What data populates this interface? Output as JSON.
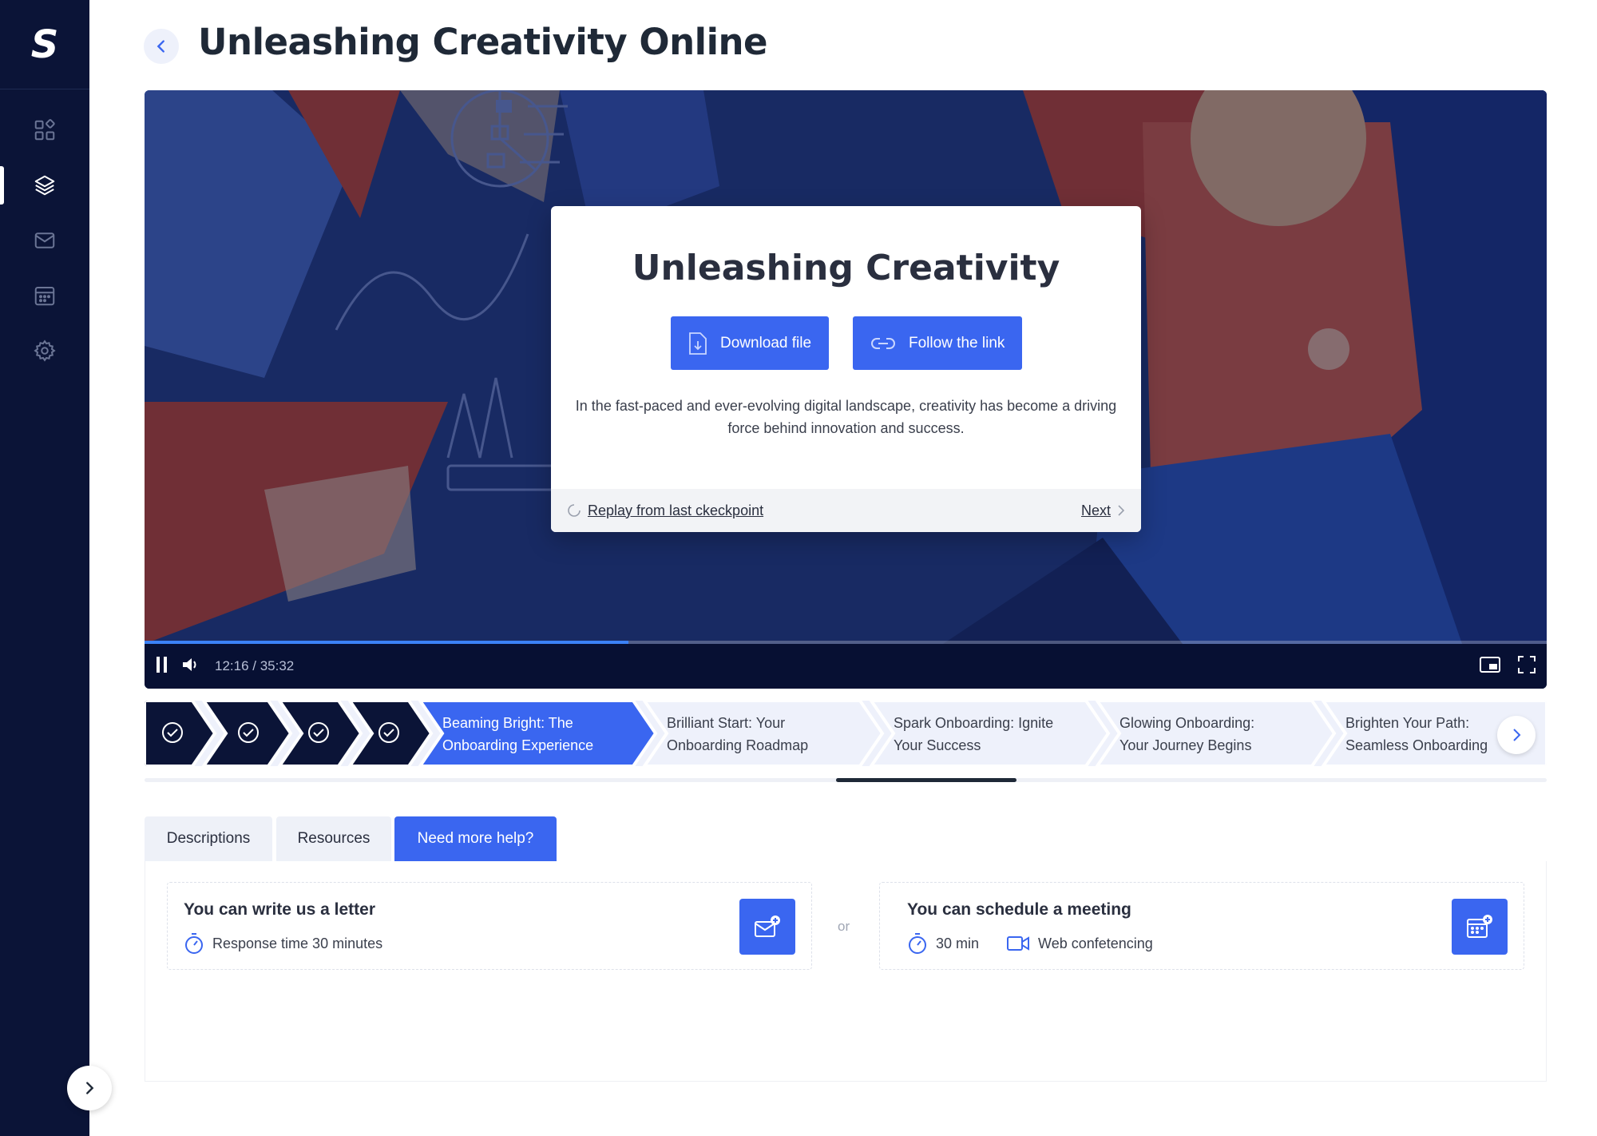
{
  "app": {
    "logo_text": "S",
    "page_title": "Unleashing Creativity Online"
  },
  "sidebar": {
    "items": [
      {
        "icon": "widgets-icon",
        "active": false
      },
      {
        "icon": "layers-icon",
        "active": true
      },
      {
        "icon": "mail-icon",
        "active": false
      },
      {
        "icon": "calendar-icon",
        "active": false
      },
      {
        "icon": "gear-icon",
        "active": false
      }
    ]
  },
  "video": {
    "time_text": "12:16 / 35:32",
    "progress_fraction": 0.345,
    "dialog": {
      "title": "Unleashing Creativity",
      "download_label": "Download file",
      "link_label": "Follow the link",
      "description": "In the fast-paced and ever-evolving digital landscape, creativity has become a driving force behind innovation and success.",
      "replay_label": "Replay from last ckeckpoint",
      "next_label": "Next"
    }
  },
  "chapters": {
    "items": [
      {
        "label": "",
        "status": "done"
      },
      {
        "label": "",
        "status": "done"
      },
      {
        "label": "",
        "status": "done"
      },
      {
        "label": "",
        "status": "done"
      },
      {
        "label_line1": "Beaming Bright: The",
        "label_line2": "Onboarding Experience",
        "status": "current"
      },
      {
        "label_line1": "Brilliant Start: Your",
        "label_line2": "Onboarding Roadmap",
        "status": "upcoming"
      },
      {
        "label_line1": "Spark Onboarding: Ignite",
        "label_line2": "Your Success",
        "status": "upcoming"
      },
      {
        "label_line1": "Glowing Onboarding:",
        "label_line2": "Your Journey Begins",
        "status": "upcoming"
      },
      {
        "label_line1": "Brighten Your Path:",
        "label_line2": "Seamless Onboarding",
        "status": "upcoming"
      }
    ]
  },
  "tabs": {
    "descriptions": "Descriptions",
    "resources": "Resources",
    "help": "Need more help?"
  },
  "help": {
    "letter": {
      "title": "You can write us a letter",
      "response": "Response time 30 minutes"
    },
    "or_text": "or",
    "meeting": {
      "title": "You can schedule a meeting",
      "duration": "30 min",
      "conferencing": "Web confetencing"
    }
  },
  "colors": {
    "accent": "#3a66f0",
    "sidebar_bg": "#0b1437",
    "chapter_done_bg": "#0b1437",
    "chapter_upcoming_bg": "#eef1fb"
  }
}
